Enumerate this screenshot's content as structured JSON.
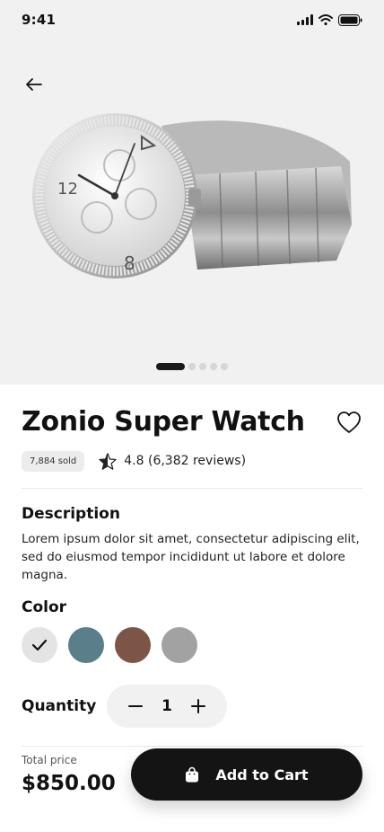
{
  "status_bar": {
    "time": "9:41"
  },
  "product": {
    "title": "Zonio Super Watch",
    "sold": "7,884 sold",
    "rating": "4.8 (6,382 reviews)",
    "image_count": 5,
    "active_image": 1
  },
  "description": {
    "title": "Description",
    "text": "Lorem ipsum dolor sit amet, consectetur adipiscing elit, sed do eiusmod tempor incididunt ut labore et dolore magna."
  },
  "color": {
    "title": "Color",
    "options": [
      {
        "name": "light-gray",
        "hex": "#e4e4e4",
        "selected": true
      },
      {
        "name": "slate-blue",
        "hex": "#5a7f8b",
        "selected": false
      },
      {
        "name": "brown",
        "hex": "#7d5547",
        "selected": false
      },
      {
        "name": "gray",
        "hex": "#a2a2a2",
        "selected": false
      }
    ]
  },
  "quantity": {
    "label": "Quantity",
    "value": "1"
  },
  "footer": {
    "price_label": "Total price",
    "price": "$850.00",
    "cart_label": "Add to Cart"
  }
}
